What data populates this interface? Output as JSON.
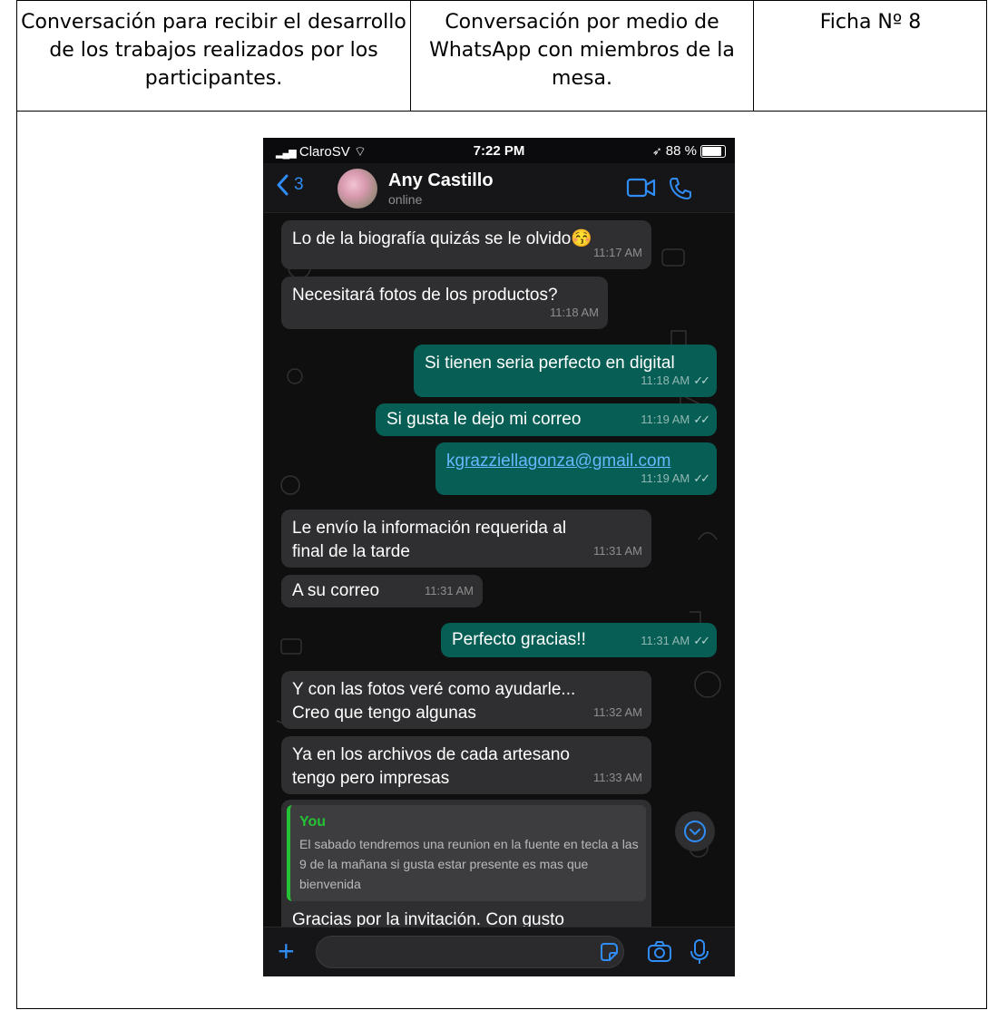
{
  "document": {
    "col1": "Conversación para recibir el desarrollo de los trabajos realizados por los participantes.",
    "col2": "Conversación por medio de WhatsApp con miembros de la mesa.",
    "col3": "Ficha Nº 8"
  },
  "status_bar": {
    "carrier": "ClaroSV",
    "time": "7:22 PM",
    "battery": "88 %"
  },
  "chat_header": {
    "back_count": "3",
    "contact_name": "Any Castillo",
    "contact_status": "online"
  },
  "messages": [
    {
      "dir": "in",
      "text": "Lo de la biografía quizás se le olvido😚",
      "time": "11:17 AM"
    },
    {
      "dir": "in",
      "text": "Necesitará fotos de los productos?",
      "time": "11:18 AM"
    },
    {
      "dir": "out",
      "text": "Si tienen seria perfecto en digital",
      "time": "11:18 AM"
    },
    {
      "dir": "out",
      "text": "Si gusta le dejo mi correo",
      "time": "11:19 AM"
    },
    {
      "dir": "out",
      "text": "kgrazziellagonza@gmail.com",
      "time": "11:19 AM"
    },
    {
      "dir": "in",
      "text": "Le envío la información requerida al final de la tarde",
      "time": "11:31 AM"
    },
    {
      "dir": "in",
      "text": "A su correo",
      "time": "11:31 AM"
    },
    {
      "dir": "out",
      "text": "Perfecto gracias!!",
      "time": "11:31 AM"
    },
    {
      "dir": "in",
      "text": "Y con las fotos veré como ayudarle... Creo que tengo algunas",
      "time": "11:32 AM"
    },
    {
      "dir": "in",
      "text": "Ya en los archivos de cada artesano tengo pero impresas",
      "time": "11:33 AM"
    }
  ],
  "reply": {
    "quote_author": "You",
    "quote_text": "El sabado tendremos una reunion en la  fuente en tecla a las 9 de la mañana si gusta estar presente es mas que bienvenida",
    "text": "Gracias por la invitación. Con gusto"
  },
  "icons": [
    "back-chevron-icon",
    "video-call-icon",
    "phone-call-icon",
    "plus-icon",
    "sticker-icon",
    "camera-icon",
    "microphone-icon",
    "scroll-down-icon"
  ],
  "colors": {
    "incoming": "#2f2f31",
    "outgoing": "#075e54",
    "accent": "#2f8df5",
    "quote_bar": "#25c235"
  }
}
